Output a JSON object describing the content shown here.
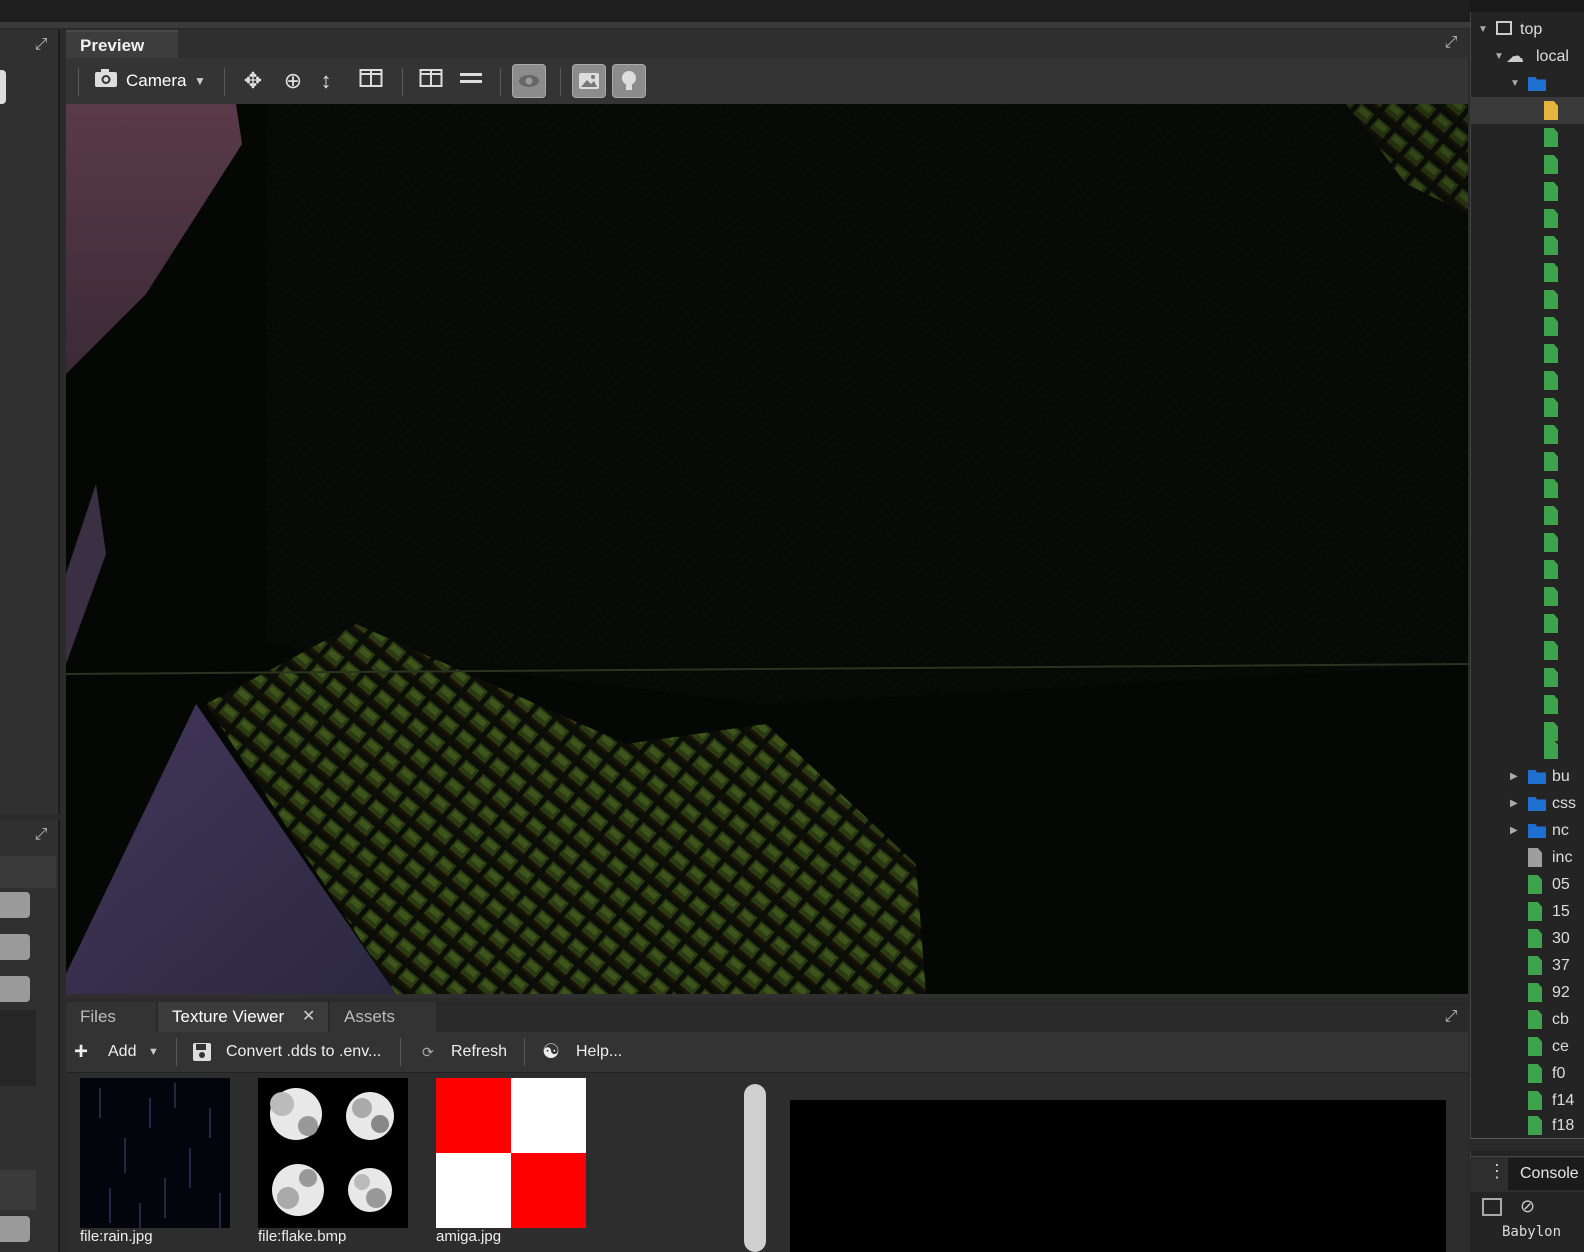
{
  "preview": {
    "tab_label": "Preview",
    "camera_label": "Camera"
  },
  "bottom": {
    "tabs": [
      {
        "label": "Files"
      },
      {
        "label": "Texture Viewer"
      },
      {
        "label": "Assets"
      }
    ],
    "toolbar": {
      "add_label": "Add",
      "convert_label": "Convert .dds to .env...",
      "refresh_label": "Refresh",
      "help_label": "Help..."
    },
    "textures": [
      {
        "label": "file:rain.jpg"
      },
      {
        "label": "file:flake.bmp"
      },
      {
        "label": "amiga.jpg"
      }
    ]
  },
  "devtools": {
    "tree": {
      "top": "top",
      "local": "local",
      "folders": [
        "bu",
        "css",
        "nc"
      ],
      "files": [
        "inc",
        "05",
        "15",
        "30",
        "37",
        "92",
        "cb",
        "ce",
        "f0",
        "f14",
        "f18"
      ]
    },
    "console_label": "Console",
    "footer_text": "Babylon"
  },
  "colors": {
    "accent_green": "#3fa34d",
    "folder_blue": "#1f6fd1",
    "file_yellow": "#e6b43c"
  }
}
